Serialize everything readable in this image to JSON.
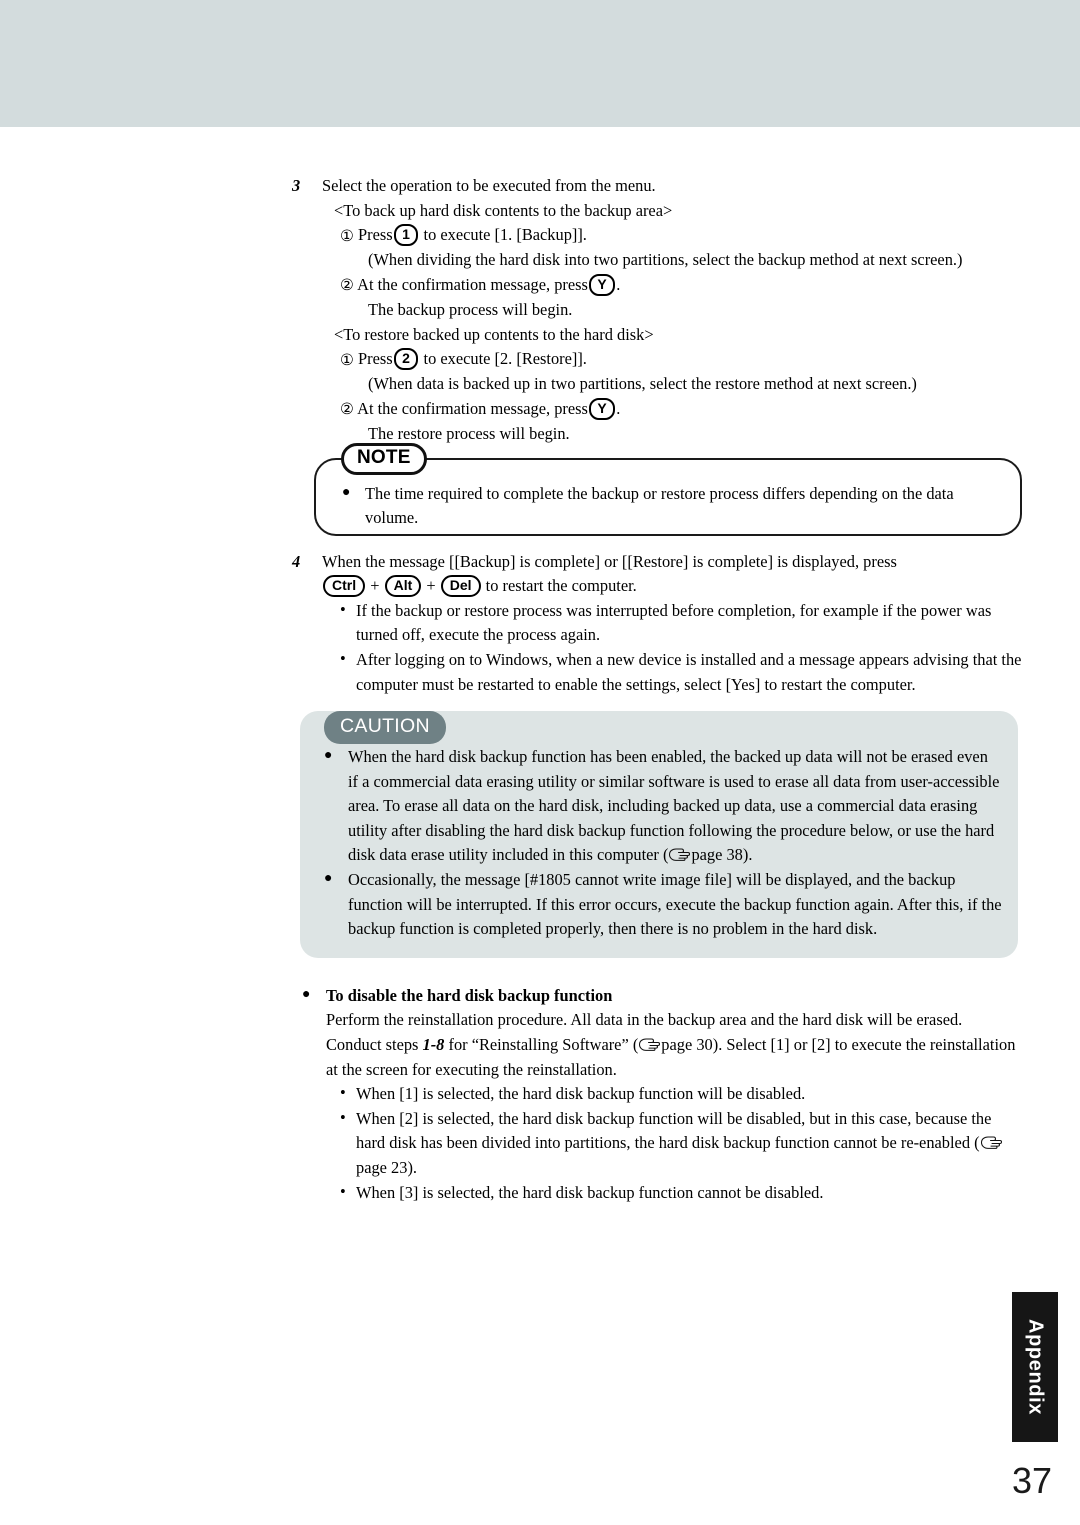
{
  "page": {
    "number": "37",
    "tab_label": "Appendix"
  },
  "steps": [
    {
      "number": "3",
      "title": "Select the operation to be executed from the menu.",
      "groups": [
        {
          "heading": "<To back up hard disk contents to the backup area>",
          "items": [
            {
              "marker": "①",
              "text_before": "Press",
              "key": "1",
              "text_after": "to execute [1. [Backup]].",
              "sub": "(When dividing the hard disk into two partitions, select the backup method at next screen.)"
            },
            {
              "marker": "②",
              "text_before": "At the confirmation message, press",
              "key": "Y",
              "text_after": ".",
              "sub": "The backup process will begin."
            }
          ]
        },
        {
          "heading": "<To restore backed up contents to the hard disk>",
          "items": [
            {
              "marker": "①",
              "text_before": "Press",
              "key": "2",
              "text_after": "to execute [2. [Restore]].",
              "sub": "(When data is backed up in two partitions, select the restore method at next screen.)"
            },
            {
              "marker": "②",
              "text_before": "At the confirmation message, press",
              "key": "Y",
              "text_after": ".",
              "sub": "The restore process will begin."
            }
          ]
        }
      ]
    }
  ],
  "note": {
    "badge": "NOTE",
    "bullet_glyph": "●",
    "items": [
      "The time required to complete the backup or restore process differs depending on the data volume."
    ]
  },
  "step4": {
    "number": "4",
    "line1": "When the message [[Backup] is complete] or [[Restore] is complete] is displayed, press",
    "keys": [
      "Ctrl",
      "Alt",
      "Del"
    ],
    "plus": "+",
    "line2_tail": "to restart the computer.",
    "bullets": [
      "If the backup or restore process was interrupted before completion, for example if the power was turned off, execute the process again.",
      "After logging on to Windows, when a new device is installed and a message appears advising that the computer must be restarted to enable the settings, select [Yes] to restart the computer."
    ],
    "dash_glyph": "•"
  },
  "caution": {
    "badge": "CAUTION",
    "badge_bg": "#6f8185",
    "panel_bg": "#dde4e4",
    "bullet_glyph": "●",
    "items": [
      {
        "text_a": "When the hard disk backup function has been enabled, the backed up data will not be erased even if a commercial data erasing utility or similar software is used to erase all data from user-accessible area. To erase all data on the hard disk, including backed up data, use a commercial data erasing utility after disabling the hard disk backup function following the procedure below, or use the hard disk data erase utility included in this computer (",
        "page_ref": "page 38",
        "text_b": ")."
      },
      {
        "text_a": "Occasionally, the message [#1805 cannot write image file] will be displayed, and the backup function will be interrupted.  If this error occurs, execute the backup function again.  After this, if the backup function is completed properly, then there is no problem in the hard disk.",
        "page_ref": "",
        "text_b": ""
      }
    ]
  },
  "disable_section": {
    "bullet_glyph": "●",
    "heading": "To disable the hard disk backup function",
    "para_a": "Perform the reinstallation procedure. All data in the backup area and the hard disk will be erased. Conduct steps ",
    "steps_range": "1-8",
    "para_b": " for “Reinstalling Software”  (",
    "page_ref": "page 30",
    "para_c": "). Select [1] or [2] to execute the reinstallation at the screen for executing the reinstallation.",
    "dash_glyph": "•",
    "bullets": [
      {
        "text_a": "When [1] is selected, the hard disk backup function will be disabled.",
        "page_ref": "",
        "text_b": ""
      },
      {
        "text_a": "When [2] is selected, the hard disk backup function will be disabled, but in this case, because the hard disk has been divided into partitions, the hard disk backup function cannot be re-enabled  (",
        "page_ref": "page 23",
        "text_b": ")."
      },
      {
        "text_a": "When [3] is selected, the hard disk backup function cannot be disabled.",
        "page_ref": "",
        "text_b": ""
      }
    ]
  },
  "icons": {
    "page_ref_icon": "pointing-hand-icon"
  }
}
